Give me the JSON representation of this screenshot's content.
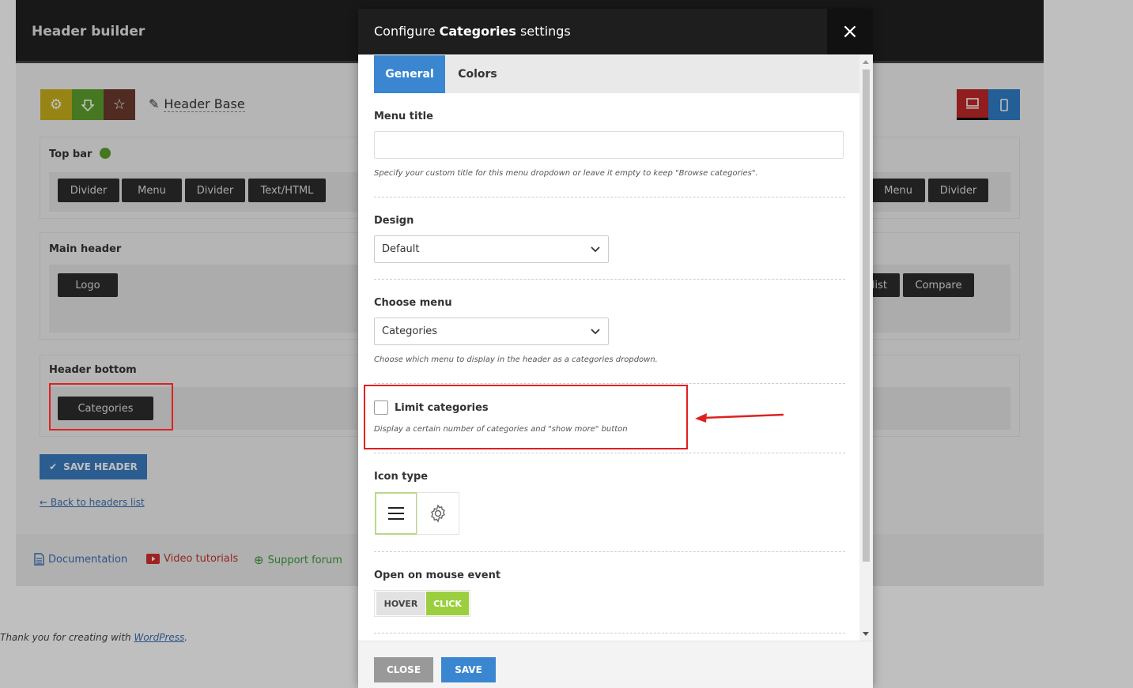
{
  "background": {
    "title": "Header builder",
    "header_name": "Header Base",
    "rows": {
      "top_bar": {
        "label": "Top bar",
        "left_items": [
          "Divider",
          "Menu",
          "Divider",
          "Text/HTML"
        ],
        "right_items": [
          "Menu",
          "Divider"
        ]
      },
      "main_header": {
        "label": "Main header",
        "left_items": [
          "Logo"
        ],
        "right_items": [
          "list",
          "Compare"
        ]
      },
      "header_bottom": {
        "label": "Header bottom",
        "left_items": [
          "Categories"
        ]
      }
    },
    "save_header": "SAVE HEADER",
    "back_link": "← Back to headers list",
    "footer_links": {
      "documentation": "Documentation",
      "video": "Video tutorials",
      "support": "Support forum"
    },
    "thankyou_prefix": "Thank you for creating with ",
    "thankyou_link": "WordPress",
    "thankyou_suffix": "."
  },
  "modal": {
    "title_prefix": "Configure ",
    "title_bold": "Categories",
    "title_suffix": " settings",
    "close_icon": "×",
    "tabs": [
      "General",
      "Colors"
    ],
    "active_tab": "General",
    "fields": {
      "menu_title": {
        "label": "Menu title",
        "value": "",
        "desc": "Specify your custom title for this menu dropdown or leave it empty to keep \"Browse categories\"."
      },
      "design": {
        "label": "Design",
        "value": "Default"
      },
      "choose_menu": {
        "label": "Choose menu",
        "value": "Categories",
        "desc": "Choose which menu to display in the header as a categories dropdown."
      },
      "limit": {
        "label": "Limit categories",
        "checked": false,
        "desc": "Display a certain number of categories and \"show more\" button"
      },
      "icon_type": {
        "label": "Icon type",
        "options": [
          "hamburger-icon",
          "gear-icon"
        ],
        "selected": "hamburger-icon"
      },
      "mouse_event": {
        "label": "Open on mouse event",
        "options": [
          "HOVER",
          "CLICK"
        ],
        "selected": "CLICK"
      }
    },
    "footer": {
      "close": "CLOSE",
      "save": "SAVE"
    }
  },
  "colors": {
    "accent_blue": "#3b86d1",
    "annotation_red": "#e02020",
    "toggle_green": "#9ccf3f"
  }
}
